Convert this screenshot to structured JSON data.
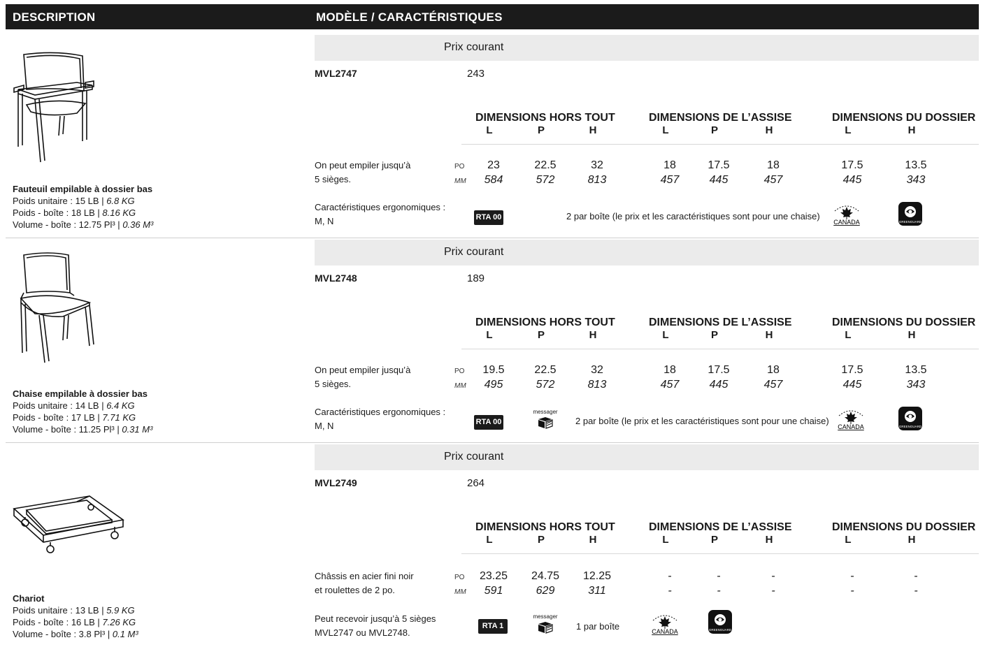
{
  "header": {
    "description": "DESCRIPTION",
    "model": "MODÈLE / CARACTÉRISTIQUES"
  },
  "labels": {
    "prix_courant": "Prix courant",
    "grp_overall": "DIMENSIONS HORS TOUT",
    "grp_seat": "DIMENSIONS DE L’ASSISE",
    "grp_back": "DIMENSIONS DU DOSSIER",
    "L": "L",
    "P": "P",
    "H": "H",
    "unit_po": "PO",
    "unit_mm": "MM",
    "rta00": "RTA 00",
    "rta1": "RTA 1",
    "messager": "messager",
    "canada": "CANADA",
    "greenguard": "GREENGUARD"
  },
  "products": [
    {
      "name": "Fauteuil empilable à dossier bas",
      "poids_unitaire": "Poids unitaire : 15 LB |",
      "poids_unitaire_kg": "6.8 KG",
      "poids_boite": "Poids - boîte : 18 LB |",
      "poids_boite_kg": "8.16 KG",
      "volume": "Volume - boîte : 12.75 Pl³ |",
      "volume_m": "0.36 M³",
      "model": "MVL2747",
      "price": "243",
      "note1": "On peut empiler jusqu’à",
      "note2": "5 sièges.",
      "po": [
        "23",
        "22.5",
        "32",
        "18",
        "17.5",
        "18",
        "17.5",
        "13.5"
      ],
      "mm": [
        "584",
        "572",
        "813",
        "457",
        "445",
        "457",
        "445",
        "343"
      ],
      "ergo1": "Caractéristiques ergonomiques :",
      "ergo2": "M, N",
      "box_note": "2 par boîte (le prix et les caractéristiques sont pour une chaise)"
    },
    {
      "name": "Chaise empilable à dossier bas",
      "poids_unitaire": "Poids unitaire : 14 LB |",
      "poids_unitaire_kg": "6.4 KG",
      "poids_boite": "Poids - boîte : 17 LB |",
      "poids_boite_kg": "7.71 KG",
      "volume": "Volume - boîte : 11.25 Pl³ |",
      "volume_m": "0.31 M³",
      "model": "MVL2748",
      "price": "189",
      "note1": "On peut empiler jusqu’à",
      "note2": "5 sièges.",
      "po": [
        "19.5",
        "22.5",
        "32",
        "18",
        "17.5",
        "18",
        "17.5",
        "13.5"
      ],
      "mm": [
        "495",
        "572",
        "813",
        "457",
        "445",
        "457",
        "445",
        "343"
      ],
      "ergo1": "Caractéristiques ergonomiques :",
      "ergo2": "M, N",
      "box_note": "2 par boîte (le prix et les caractéristiques sont pour une chaise)"
    },
    {
      "name": "Chariot",
      "poids_unitaire": "Poids unitaire : 13 LB |",
      "poids_unitaire_kg": "5.9 KG",
      "poids_boite": "Poids - boîte : 16 LB |",
      "poids_boite_kg": "7.26 KG",
      "volume": "Volume - boîte : 3.8 Pl³ |",
      "volume_m": "0.1 M³",
      "model": "MVL2749",
      "price": "264",
      "note1": "Châssis en acier fini noir",
      "note2": "et roulettes de 2 po.",
      "po": [
        "23.25",
        "24.75",
        "12.25",
        "-",
        "-",
        "-",
        "-",
        "-"
      ],
      "mm": [
        "591",
        "629",
        "311",
        "-",
        "-",
        "-",
        "-",
        "-"
      ],
      "ergo1": "Peut recevoir jusqu’à 5 sièges",
      "ergo2": "MVL2747 ou MVL2748.",
      "box_note": "1 par boîte"
    }
  ]
}
